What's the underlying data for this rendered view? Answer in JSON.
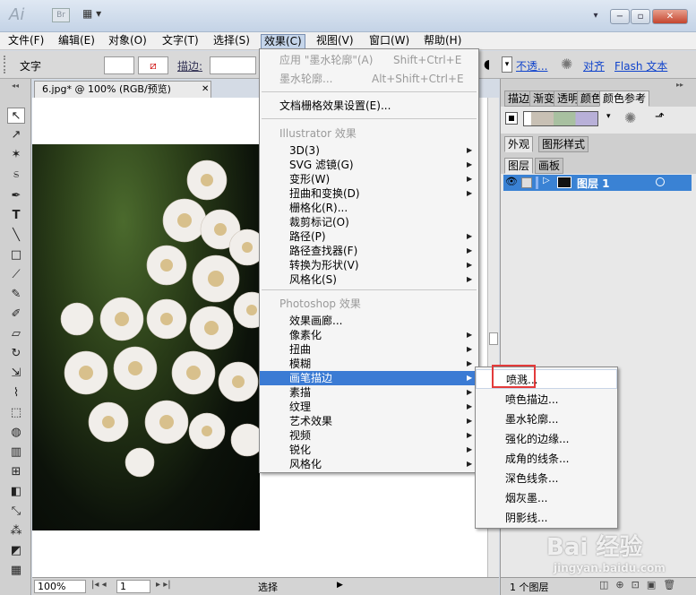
{
  "app": {
    "logo": "Ai",
    "bridge": "Br",
    "arrange": "▦ ▾"
  },
  "window_controls": {
    "menu": "▾",
    "minimize": "−",
    "maximize": "▫",
    "close": "✕"
  },
  "menubar": [
    "文件(F)",
    "编辑(E)",
    "对象(O)",
    "文字(T)",
    "选择(S)",
    "效果(C)",
    "视图(V)",
    "窗口(W)",
    "帮助(H)"
  ],
  "control_bar": {
    "label": "文字",
    "stroke_label": "描边:",
    "opacity": "不透...",
    "align": "对齐",
    "flash_text": "Flash 文本"
  },
  "document": {
    "tab_title": "6.jpg* @ 100% (RGB/预览)",
    "close": "✕"
  },
  "status_bar": {
    "zoom": "100%",
    "page": "1",
    "mode": "选择"
  },
  "effect_menu": {
    "apply_last": "应用 \"墨水轮廓\"(A)",
    "apply_last_shortcut": "Shift+Ctrl+E",
    "last_effect": "墨水轮廓...",
    "last_effect_shortcut": "Alt+Shift+Ctrl+E",
    "raster_settings": "文档栅格效果设置(E)...",
    "illustrator_header": "Illustrator 效果",
    "illustrator_items": [
      "3D(3)",
      "SVG 滤镜(G)",
      "变形(W)",
      "扭曲和变换(D)",
      "栅格化(R)...",
      "裁剪标记(O)",
      "路径(P)",
      "路径查找器(F)",
      "转换为形状(V)",
      "风格化(S)"
    ],
    "photoshop_header": "Photoshop 效果",
    "photoshop_items": [
      "效果画廊...",
      "像素化",
      "扭曲",
      "模糊",
      "画笔描边",
      "素描",
      "纹理",
      "艺术效果",
      "视频",
      "锐化",
      "风格化"
    ]
  },
  "brush_submenu": [
    "喷溅...",
    "喷色描边...",
    "墨水轮廓...",
    "强化的边缘...",
    "成角的线条...",
    "深色线条...",
    "烟灰墨...",
    "阴影线..."
  ],
  "right_panel": {
    "top_tabs": [
      "描边",
      "渐变",
      "透明",
      "颜色",
      "颜色参考"
    ],
    "mid_tabs": [
      "外观",
      "图形样式"
    ],
    "layer_tabs": [
      "图层",
      "画板"
    ],
    "layer_name": "图层 1",
    "layer_count": "1 个图层"
  },
  "watermark": {
    "brand": "Bai  经验",
    "url": "jingyan.baidu.com"
  },
  "colors": {
    "highlight": "#3b7bd4",
    "layer_selected": "#3a82d4",
    "redbox": "#e33b3b"
  }
}
